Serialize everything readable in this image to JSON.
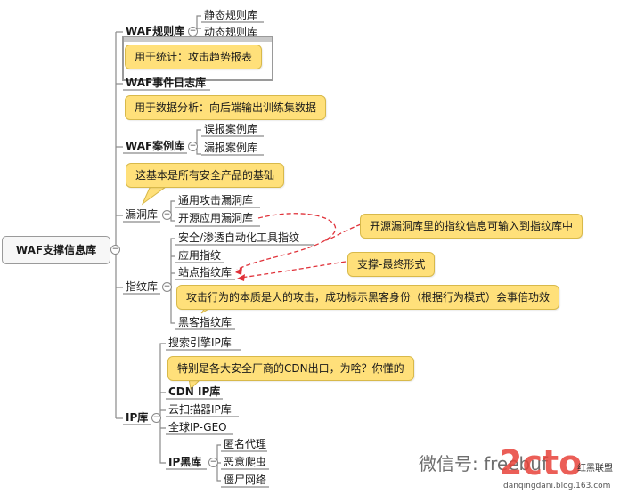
{
  "root": {
    "label": "WAF支撑信息库"
  },
  "branches": {
    "waf_rules": {
      "label": "WAF规则库",
      "children": [
        "静态规则库",
        "动态规则库"
      ]
    },
    "waf_events": {
      "label": "WAF事件日志库"
    },
    "waf_cases": {
      "label": "WAF案例库",
      "children": [
        "误报案例库",
        "漏报案例库"
      ]
    },
    "vuln": {
      "label": "漏洞库",
      "children": [
        "通用攻击漏洞库",
        "开源应用漏洞库"
      ]
    },
    "fingerprint": {
      "label": "指纹库",
      "children": [
        "安全/渗透自动化工具指纹",
        "应用指纹",
        "站点指纹库",
        "黑客指纹库"
      ]
    },
    "ip": {
      "label": "IP库",
      "children": [
        "搜索引擎IP库",
        "CDN IP库",
        "云扫描器IP库",
        "全球IP-GEO"
      ],
      "blacklist": {
        "label": "IP黑库",
        "children": [
          "匿名代理",
          "恶意爬虫",
          "僵尸网络"
        ]
      }
    }
  },
  "callouts": {
    "stats": "用于统计：攻击趋势报表",
    "analysis": "用于数据分析：向后端输出训练集数据",
    "foundation": "这基本是所有安全产品的基础",
    "fingerprint_input": "开源漏洞库里的指纹信息可输入到指纹库中",
    "support": "支撑-最终形式",
    "attack_nature": "攻击行为的本质是人的攻击，成功标示黑客身份（根据行为模式）会事倍功效",
    "cdn": "特别是各大安全厂商的CDN出口，为啥？你懂的"
  },
  "toggle_symbol": "−",
  "watermark": {
    "text": "微信号: freebuf",
    "logo": "2cto",
    "logo_small": "红黑联盟",
    "url": "danqingdani.blog.163.com"
  },
  "colors": {
    "callout_fill": "#ffe07a",
    "callout_border": "#d8b94a",
    "dashed_link": "#e0323a",
    "line": "#8a8a8a"
  }
}
